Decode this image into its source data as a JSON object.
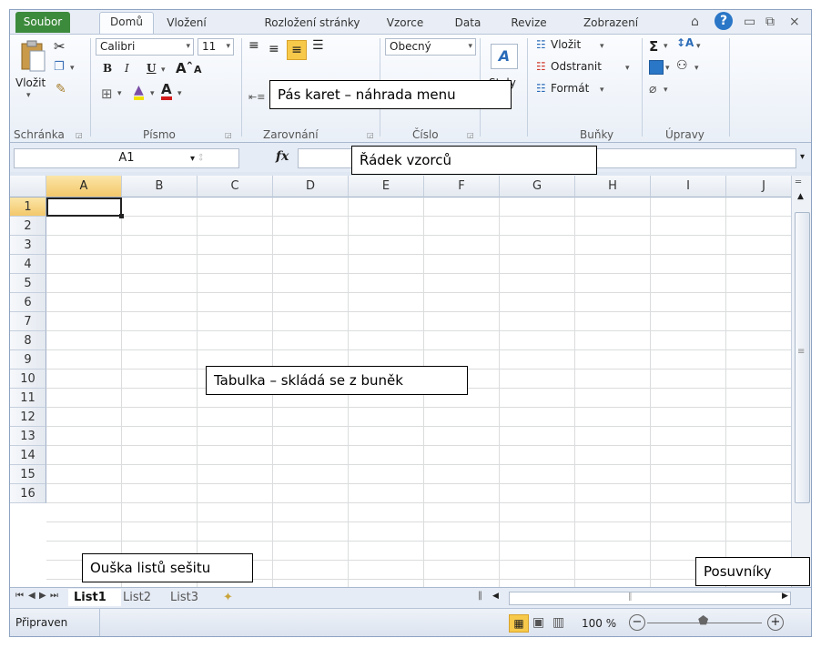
{
  "ribbon_tabs": {
    "file": "Soubor",
    "home": "Domů",
    "insert": "Vložení",
    "layout": "Rozložení stránky",
    "formulas": "Vzorce",
    "data": "Data",
    "review": "Revize",
    "view": "Zobrazení"
  },
  "clipboard": {
    "paste": "Vložit",
    "label": "Schránka"
  },
  "font": {
    "name": "Calibri",
    "size": "11",
    "bold": "B",
    "italic": "I",
    "underline": "U",
    "label": "Písmo"
  },
  "alignment": {
    "label": "Zarovnání"
  },
  "number": {
    "format": "Obecný",
    "label": "Číslo"
  },
  "styles": {
    "styles_btn": "Styly"
  },
  "cells": {
    "insert": "Vložit",
    "delete": "Odstranit",
    "format": "Formát",
    "label": "Buňky"
  },
  "editing": {
    "label": "Úpravy"
  },
  "formula_bar": {
    "name_box": "A1",
    "fx": "fx"
  },
  "columns": [
    "A",
    "B",
    "C",
    "D",
    "E",
    "F",
    "G",
    "H",
    "I",
    "J"
  ],
  "rows": [
    "1",
    "2",
    "3",
    "4",
    "5",
    "6",
    "7",
    "8",
    "9",
    "10",
    "11",
    "12",
    "13",
    "14",
    "15",
    "16"
  ],
  "sheets": [
    "List1",
    "List2",
    "List3"
  ],
  "status": {
    "ready": "Připraven",
    "zoom": "100 %"
  },
  "callouts": {
    "ribbon": "Pás karet – náhrada menu",
    "formula": "Řádek vzorců",
    "table": "Tabulka – skládá se z buněk",
    "sheet_tabs": "Ouška listů sešitu",
    "scrollbars": "Posuvníky"
  },
  "colors": {
    "file_tab": "#3c8a3c",
    "selection_header": "#f3c76a",
    "help": "#2a76c7"
  }
}
